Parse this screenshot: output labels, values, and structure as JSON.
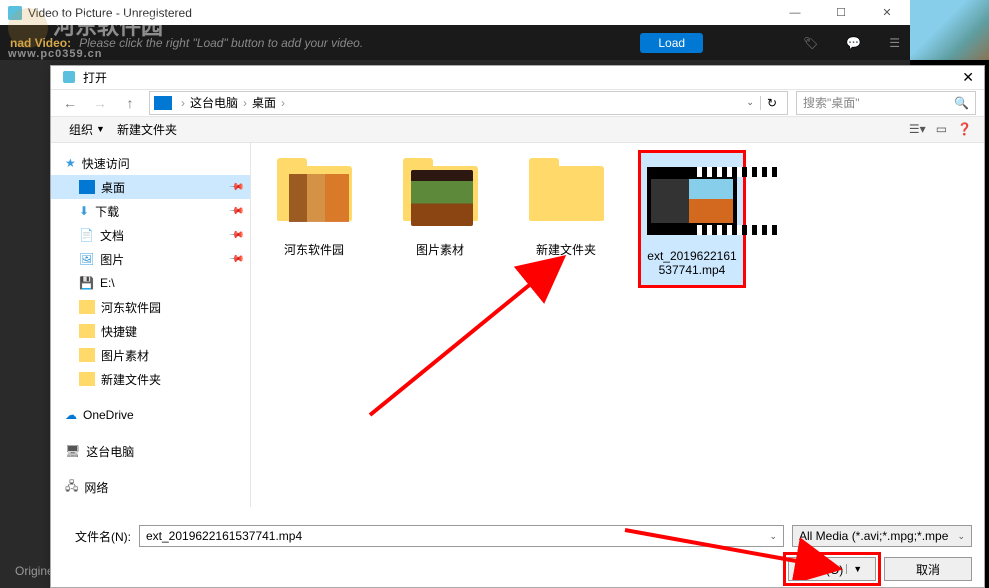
{
  "app": {
    "title": "Video to Picture - Unregistered",
    "toolbar_label": "nad Video:",
    "toolbar_hint": "Please click the right \"Load\" button to add your video.",
    "load_button": "Load",
    "origine": "Origine"
  },
  "watermark": {
    "text": "河东软件园",
    "url": "www.pc0359.cn"
  },
  "dialog": {
    "title": "打开",
    "breadcrumb": {
      "root": "这台电脑",
      "current": "桌面"
    },
    "search_placeholder": "搜索\"桌面\"",
    "toolbar": {
      "organize": "组织",
      "new_folder": "新建文件夹"
    },
    "sidebar": {
      "quick_access": "快速访问",
      "items": [
        {
          "label": "桌面",
          "pinned": true,
          "active": true,
          "icon": "desktop"
        },
        {
          "label": "下载",
          "pinned": true,
          "icon": "download"
        },
        {
          "label": "文档",
          "pinned": true,
          "icon": "document"
        },
        {
          "label": "图片",
          "pinned": true,
          "icon": "picture"
        },
        {
          "label": "E:\\",
          "icon": "drive"
        },
        {
          "label": "河东软件园",
          "icon": "folder"
        },
        {
          "label": "快捷键",
          "icon": "folder"
        },
        {
          "label": "图片素材",
          "icon": "folder"
        },
        {
          "label": "新建文件夹",
          "icon": "folder"
        }
      ],
      "onedrive": "OneDrive",
      "this_pc": "这台电脑",
      "network": "网络"
    },
    "files": [
      {
        "name": "河东软件园",
        "type": "folder"
      },
      {
        "name": "图片素材",
        "type": "folder"
      },
      {
        "name": "新建文件夹",
        "type": "folder"
      },
      {
        "name": "ext_2019622161537741.mp4",
        "type": "video",
        "selected": true
      }
    ],
    "footer": {
      "filename_label": "文件名(N):",
      "filename_value": "ext_2019622161537741.mp4",
      "filter": "All Media (*.avi;*.mpg;*.mpe",
      "open_btn": "打开(O)",
      "cancel_btn": "取消"
    }
  }
}
